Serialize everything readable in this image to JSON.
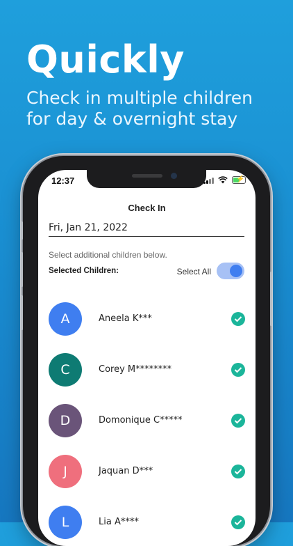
{
  "promo": {
    "headline": "Quickly",
    "subline": "Check in multiple children for day & overnight stay"
  },
  "status_bar": {
    "time": "12:37"
  },
  "screen": {
    "title": "Check In",
    "date": "Fri, Jan 21, 2022",
    "hint": "Select additional children below.",
    "selected_label": "Selected Children:",
    "select_all_label": "Select All",
    "select_all_on": true
  },
  "children": [
    {
      "initial": "A",
      "name": "Aneela K***",
      "color": "#3f7ef0",
      "checked": true
    },
    {
      "initial": "C",
      "name": "Corey M********",
      "color": "#0e7b73",
      "checked": true
    },
    {
      "initial": "D",
      "name": "Domonique C*****",
      "color": "#6a5479",
      "checked": true
    },
    {
      "initial": "J",
      "name": "Jaquan D***",
      "color": "#ef6f7d",
      "checked": true
    },
    {
      "initial": "L",
      "name": "Lia A****",
      "color": "#3f7ef0",
      "checked": true
    }
  ],
  "colors": {
    "accent": "#3f7ef0",
    "check": "#1bb59a"
  }
}
